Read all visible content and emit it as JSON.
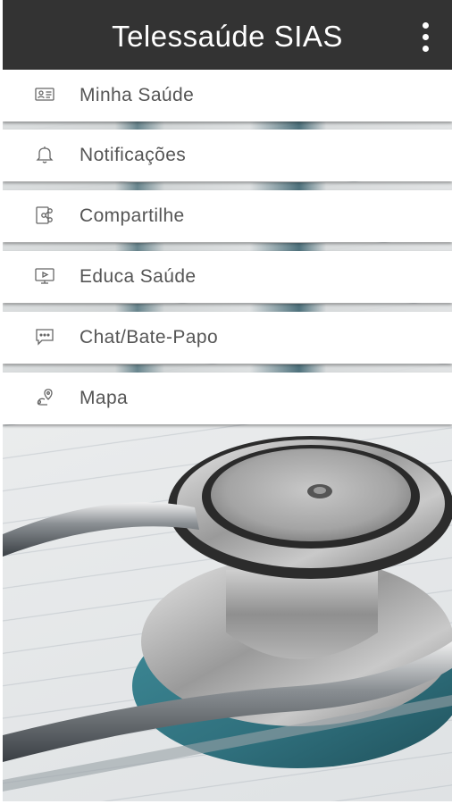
{
  "app_bar": {
    "title": "Telessaúde SIAS",
    "overflow_icon": "more-vert-icon"
  },
  "menu": {
    "items": [
      {
        "label": "Minha Saúde",
        "icon": "id-card-icon"
      },
      {
        "label": "Notificações",
        "icon": "bell-icon"
      },
      {
        "label": "Compartilhe",
        "icon": "share-icon"
      },
      {
        "label": "Educa Saúde",
        "icon": "video-monitor-icon"
      },
      {
        "label": "Chat/Bate-Papo",
        "icon": "chat-bubble-icon"
      },
      {
        "label": "Mapa",
        "icon": "map-pin-icon"
      }
    ]
  },
  "colors": {
    "app_bar_bg": "#333333",
    "app_bar_text": "#ffffff",
    "menu_text": "#555555",
    "icon_stroke": "#666666",
    "stethoscope_teal": "#2f6f7c"
  },
  "background_image": "stethoscope-photo"
}
